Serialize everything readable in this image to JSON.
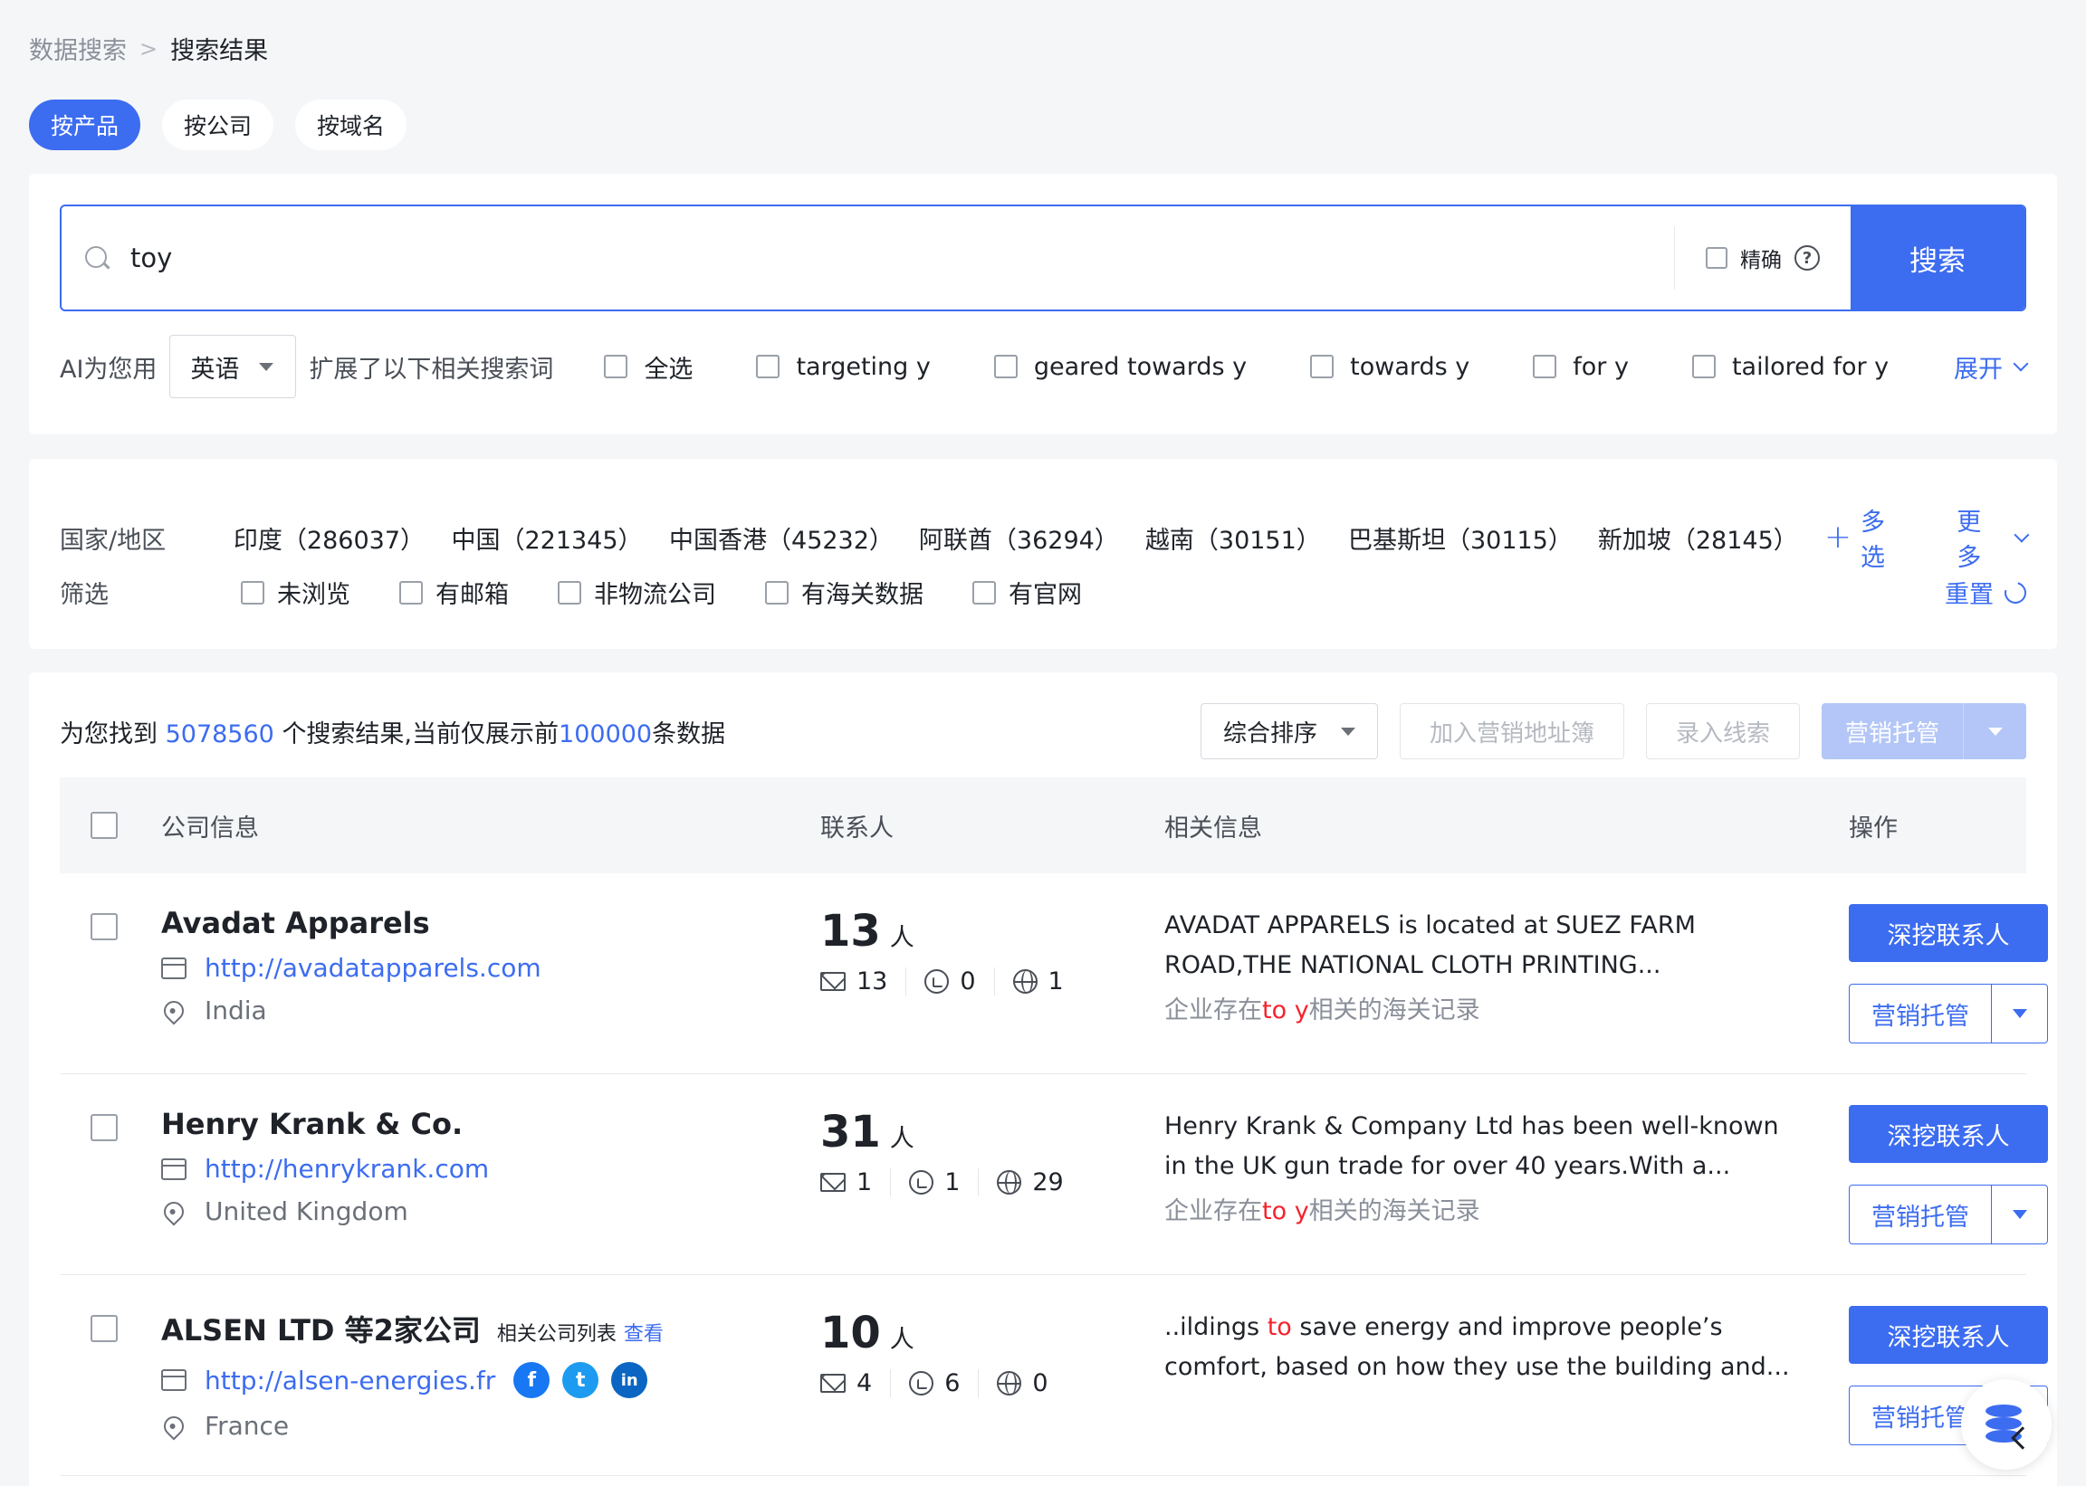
{
  "breadcrumb": {
    "parent": "数据搜索",
    "separator": ">",
    "current": "搜索结果"
  },
  "mode_tabs": [
    {
      "label": "按产品",
      "active": true
    },
    {
      "label": "按公司",
      "active": false
    },
    {
      "label": "按域名",
      "active": false
    }
  ],
  "search": {
    "value": "toy",
    "exact_label": "精确",
    "help": "?",
    "button": "搜索"
  },
  "ai_expand": {
    "label": "AI为您用",
    "language": "英语",
    "desc": "扩展了以下相关搜索词",
    "select_all": "全选",
    "terms": [
      "targeting y",
      "geared towards y",
      "towards y",
      "for y",
      "tailored for y"
    ],
    "expand": "展开"
  },
  "region": {
    "label": "国家/地区",
    "items": [
      "印度（286037）",
      "中国（221345）",
      "中国香港（45232）",
      "阿联酋（36294）",
      "越南（30151）",
      "巴基斯坦（30115）",
      "新加坡（28145）"
    ],
    "multi": "多选",
    "more": "更多"
  },
  "filters": {
    "label": "筛选",
    "items": [
      "未浏览",
      "有邮箱",
      "非物流公司",
      "有海关数据",
      "有官网"
    ],
    "reset": "重置"
  },
  "results": {
    "prefix": "为您找到",
    "total": "5078560",
    "middle": "个搜索结果,当前仅展示前",
    "limit": "100000",
    "suffix": "条数据",
    "sort": "综合排序",
    "add_book": "加入营销地址簿",
    "add_lead": "录入线索",
    "managed": "营销托管"
  },
  "table_head": {
    "company": "公司信息",
    "contacts": "联系人",
    "info": "相关信息",
    "ops": "操作"
  },
  "rows": [
    {
      "name": "Avadat Apparels",
      "url": "http://avadatapparels.com",
      "location": "India",
      "contacts": "13",
      "unit": "人",
      "email": "13",
      "whatsapp": "0",
      "web": "1",
      "desc": "AVADAT APPARELS is located at SUEZ FARM ROAD,THE NATIONAL CLOTH PRINTING...",
      "cust_prefix": "企业存在",
      "cust_hl": "to y",
      "cust_suffix": "相关的海关记录",
      "dig": "深挖联系人",
      "managed": "营销托管"
    },
    {
      "name": "Henry Krank & Co.",
      "url": "http://henrykrank.com",
      "location": "United Kingdom",
      "contacts": "31",
      "unit": "人",
      "email": "1",
      "whatsapp": "1",
      "web": "29",
      "desc": "Henry Krank & Company Ltd has been well-known in the UK gun trade for over 40 years.With a...",
      "cust_prefix": "企业存在",
      "cust_hl": "to y",
      "cust_suffix": "相关的海关记录",
      "dig": "深挖联系人",
      "managed": "营销托管"
    },
    {
      "name": "ALSEN LTD 等2家公司",
      "related": "相关公司列表",
      "view": "查看",
      "url": "http://alsen-energies.fr",
      "location": "France",
      "contacts": "10",
      "unit": "人",
      "email": "4",
      "whatsapp": "6",
      "web": "0",
      "desc_prefix": "..ildings ",
      "desc_hl": "to",
      "desc_suffix": " save energy and improve people’s comfort, based on how they use the building and...",
      "dig": "深挖联系人",
      "managed": "营销托管"
    }
  ],
  "social": {
    "facebook": "f",
    "twitter": "t",
    "linkedin": "in"
  }
}
